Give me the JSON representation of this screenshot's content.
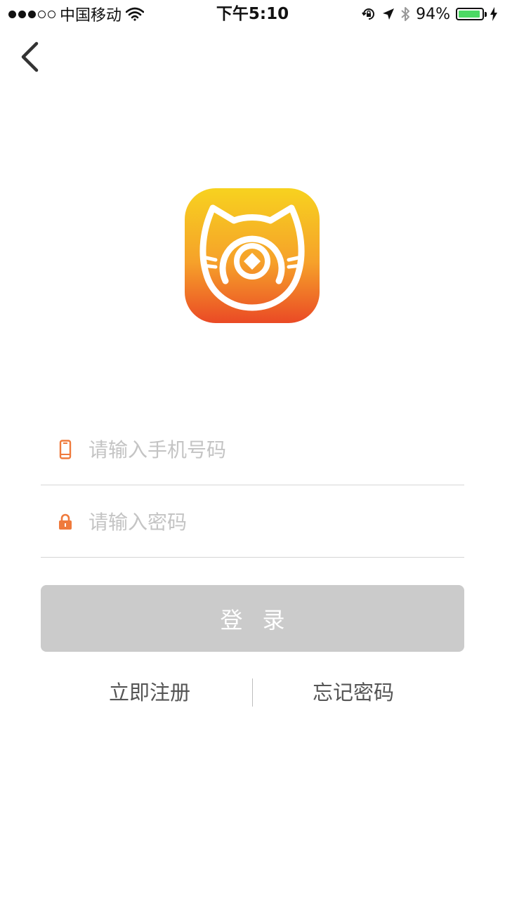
{
  "status_bar": {
    "carrier": "中国移动",
    "time": "下午5:10",
    "battery_percent": "94%",
    "battery_level": 0.94,
    "icons": [
      "signal-dots",
      "wifi-icon",
      "rotation-lock-icon",
      "location-arrow-icon",
      "bluetooth-icon",
      "battery-icon",
      "charging-bolt-icon"
    ]
  },
  "nav": {
    "back_icon": "chevron-left-icon"
  },
  "logo": {
    "icon": "cat-coin-logo",
    "colors": [
      "#f7d21f",
      "#f6a12a",
      "#ea4a25"
    ]
  },
  "form": {
    "phone": {
      "placeholder": "请输入手机号码",
      "value": "",
      "icon": "phone-icon"
    },
    "password": {
      "placeholder": "请输入密码",
      "value": "",
      "icon": "lock-icon"
    },
    "accent_color": "#ef7a3c",
    "login_label": "登录"
  },
  "links": {
    "register": "立即注册",
    "forgot": "忘记密码"
  }
}
